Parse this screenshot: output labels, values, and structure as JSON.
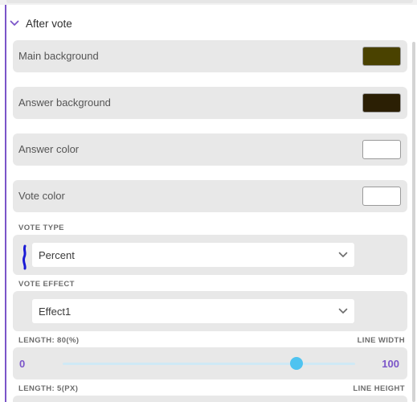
{
  "section": {
    "title": "After vote"
  },
  "colors": {
    "main_background": "#4a4200",
    "answer_background": "#2b1f04",
    "answer_color": "#ffffff",
    "vote_color": "#ffffff",
    "accent": "#7b55c9",
    "slider": "#4fc3f0"
  },
  "rows": [
    {
      "label": "Main background"
    },
    {
      "label": "Answer background"
    },
    {
      "label": "Answer color"
    },
    {
      "label": "Vote color"
    }
  ],
  "vote_type": {
    "caption": "VOTE TYPE",
    "selected": "Percent"
  },
  "vote_effect": {
    "caption": "VOTE EFFECT",
    "selected": "Effect1"
  },
  "length": {
    "caption": "LENGTH: 80(%)",
    "right_caption": "LINE WIDTH",
    "min": "0",
    "max": "100",
    "value": 80
  },
  "length_px": {
    "caption": "LENGTH: 5(PX)",
    "right_caption": "LINE HEIGHT"
  }
}
